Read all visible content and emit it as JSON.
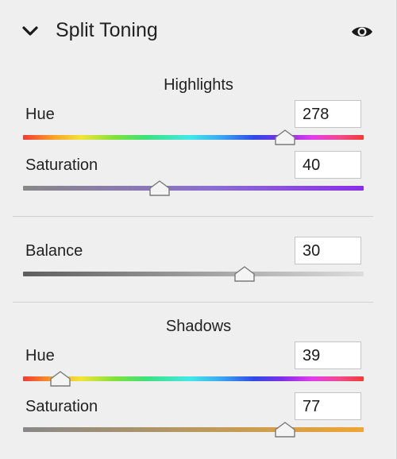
{
  "panel": {
    "title": "Split Toning",
    "icons": {
      "collapse": "chevron-down-icon",
      "visibility": "eye-icon"
    }
  },
  "highlights": {
    "title": "Highlights",
    "hue": {
      "label": "Hue",
      "value": "278",
      "fraction": 0.77
    },
    "saturation": {
      "label": "Saturation",
      "value": "40",
      "fraction": 0.4
    }
  },
  "balance": {
    "label": "Balance",
    "value": "30",
    "fraction": 0.65
  },
  "shadows": {
    "title": "Shadows",
    "hue": {
      "label": "Hue",
      "value": "39",
      "fraction": 0.11
    },
    "saturation": {
      "label": "Saturation",
      "value": "77",
      "fraction": 0.77
    }
  },
  "colors": {
    "panel_bg": "#efefef",
    "divider": "#cfcfcf",
    "highlight_sat_accent": "#8a2fe8",
    "shadow_sat_accent": "#efa533"
  }
}
